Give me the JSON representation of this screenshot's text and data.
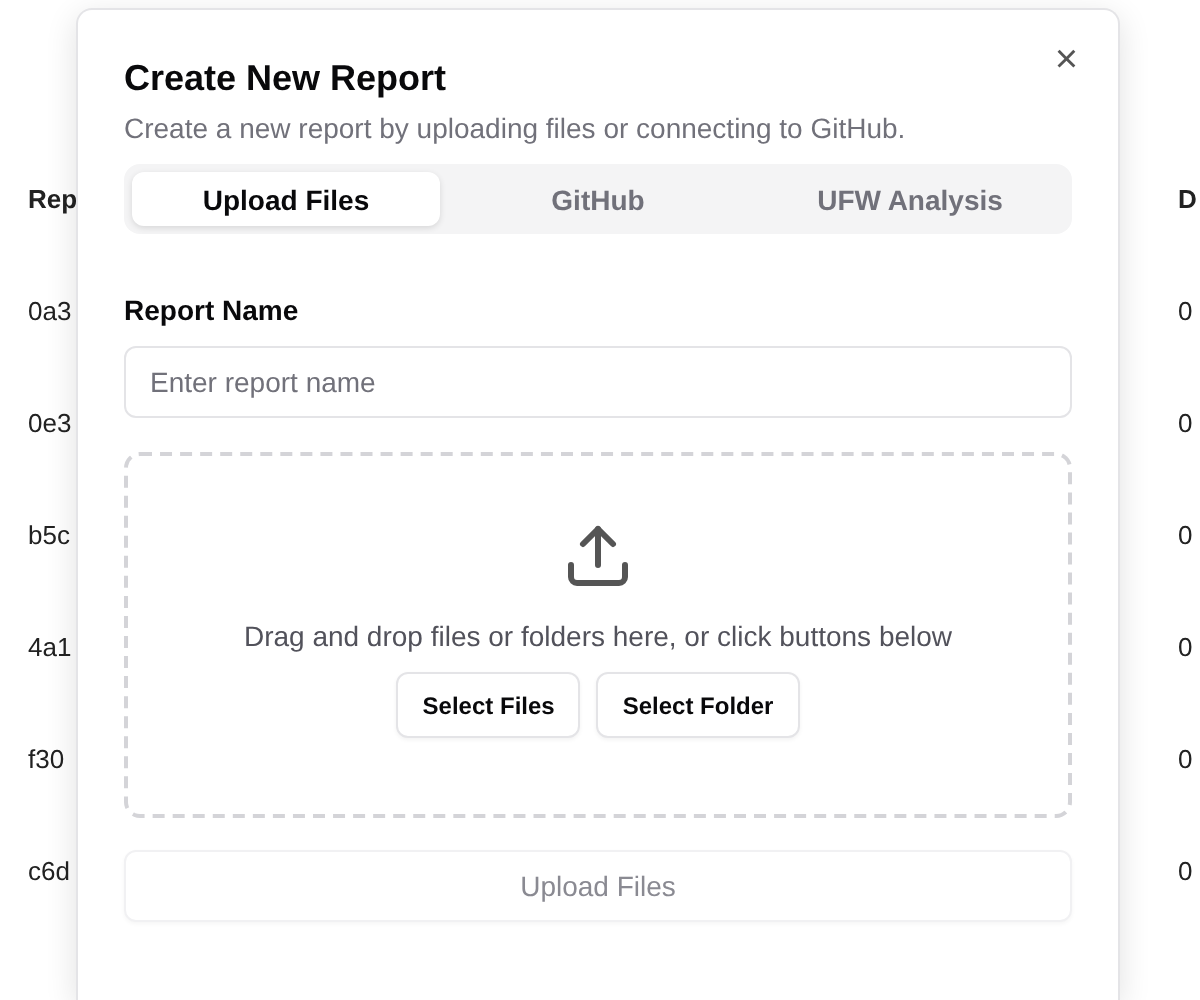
{
  "background_table": {
    "column_1": [
      "Rep",
      "0a3",
      "0e3",
      "b5c",
      "4a1",
      "f30",
      "c6d"
    ],
    "column_2": [
      "D",
      "0",
      "0",
      "0",
      "0",
      "0",
      "0"
    ]
  },
  "dialog": {
    "title": "Create New Report",
    "subtitle": "Create a new report by uploading files or connecting to GitHub.",
    "close": "×",
    "tabs": [
      {
        "label": "Upload Files",
        "selected": true
      },
      {
        "label": "GitHub",
        "selected": false
      },
      {
        "label": "UFW Analysis",
        "selected": false
      }
    ],
    "report_name": {
      "label": "Report Name",
      "placeholder": "Enter report name"
    },
    "dropzone": {
      "text": "Drag and drop files or folders here, or click buttons below",
      "buttons": [
        "Select Files",
        "Select Folder"
      ]
    },
    "upload_button": {
      "label": "Upload Files",
      "disabled": true
    }
  }
}
